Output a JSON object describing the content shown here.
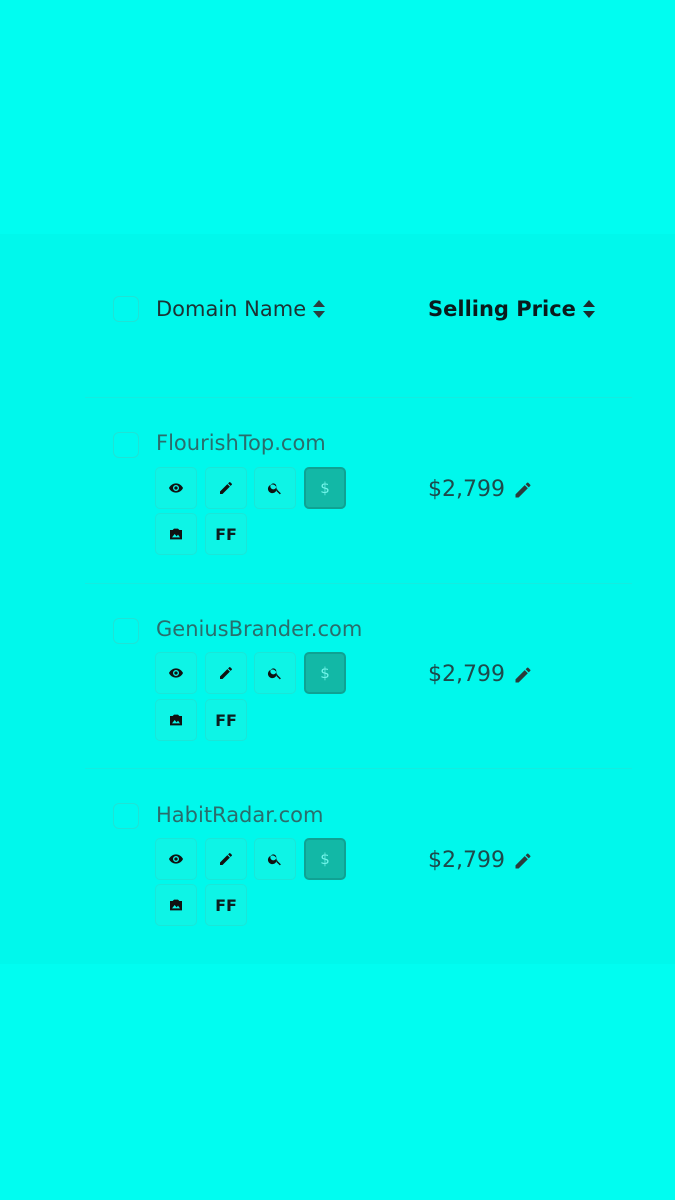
{
  "table": {
    "headers": {
      "domain_label": "Domain Name",
      "price_label": "Selling Price"
    },
    "rows": [
      {
        "domain": "FlourishTop.com",
        "price": "$2,799",
        "dollar_label": "$",
        "ff_label": "FF"
      },
      {
        "domain": "GeniusBrander.com",
        "price": "$2,799",
        "dollar_label": "$",
        "ff_label": "FF"
      },
      {
        "domain": "HabitRadar.com",
        "price": "$2,799",
        "dollar_label": "$",
        "ff_label": "FF"
      }
    ]
  },
  "icons": {
    "sort": "sort-icon",
    "view": "eye-icon",
    "edit": "pencil-icon",
    "search": "search-icon",
    "dollar": "dollar-icon",
    "image": "image-icon",
    "price_edit": "pencil-icon"
  },
  "colors": {
    "background": "#00fdf1",
    "accent_button": "#12b8a6",
    "text": "#1b3a3c"
  }
}
